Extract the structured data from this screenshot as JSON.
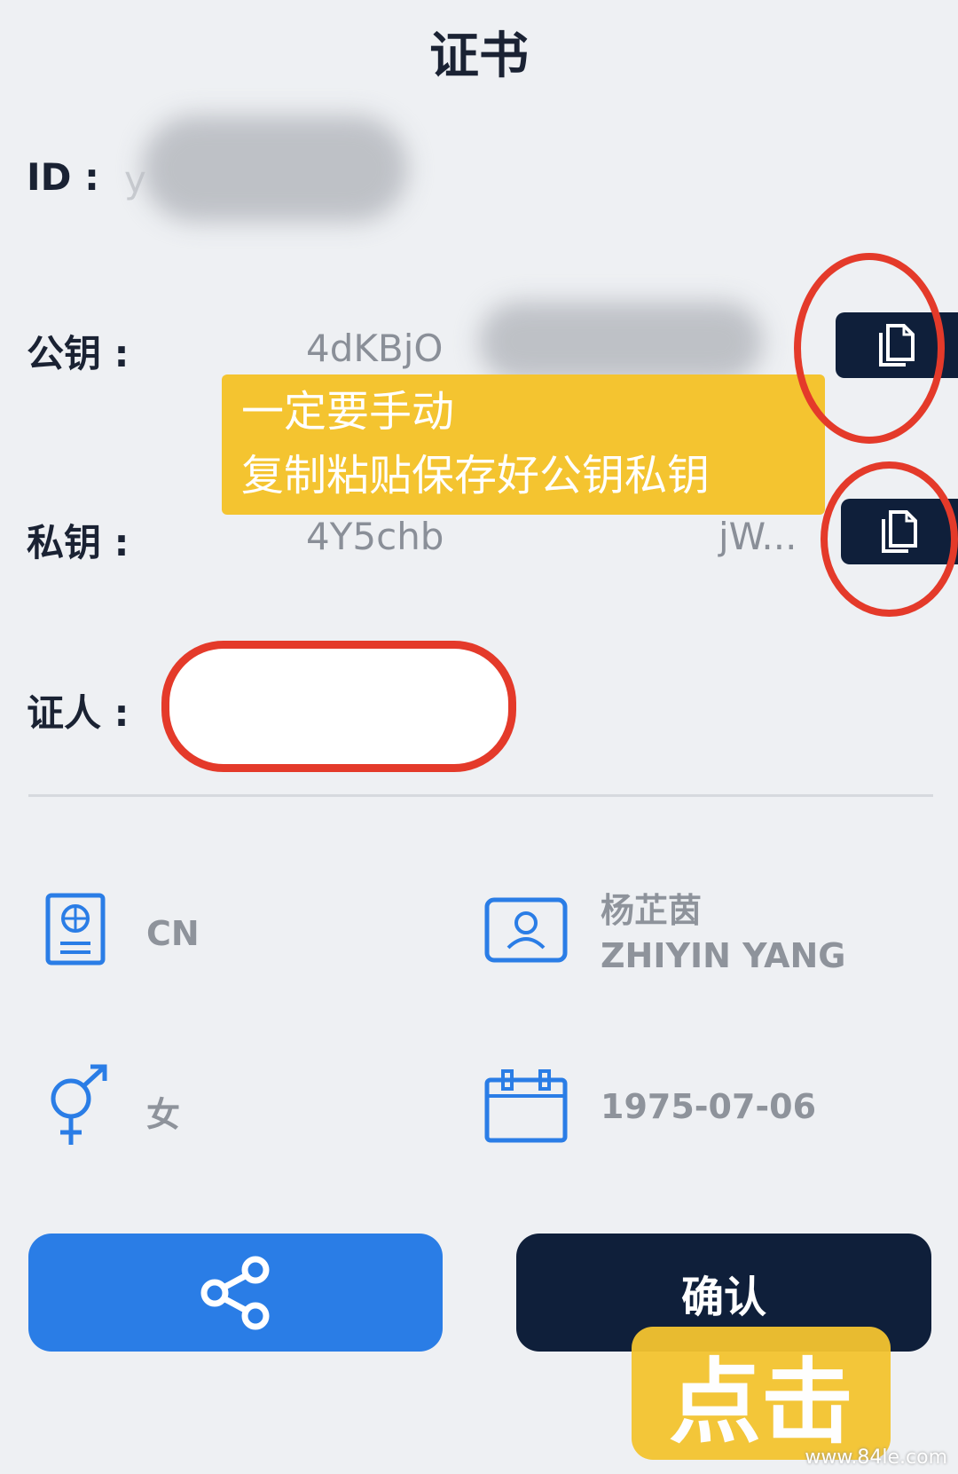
{
  "header": {
    "title": "证书"
  },
  "fields": {
    "id_label": "ID :",
    "id_value": "y",
    "public_key_label": "公钥 :",
    "public_key_value": "4dKBjO",
    "private_key_label": "私钥 :",
    "private_key_value": "4Y5chb",
    "private_key_tail": "jW...",
    "witness_label": "证人 :"
  },
  "annotation": {
    "banner_line1": "一定要手动",
    "banner_line2": "复制粘贴保存好公钥私钥",
    "tap_hint": "点击"
  },
  "info": {
    "nationality": "CN",
    "name_cn": "杨芷茵",
    "name_en": "ZHIYIN YANG",
    "gender": "女",
    "birthdate": "1975-07-06"
  },
  "buttons": {
    "confirm_label": "确认"
  },
  "watermark": "www.84le.com",
  "icons": {
    "passport": "passport-icon",
    "person_card": "id-card-icon",
    "gender": "gender-icon",
    "calendar": "calendar-icon",
    "copy": "copy-icon",
    "share": "share-icon"
  },
  "colors": {
    "accent_blue": "#2a7de6",
    "navy": "#0f1f3a",
    "annotation_red": "#e43a2a",
    "annotation_yellow": "#f4c430"
  }
}
